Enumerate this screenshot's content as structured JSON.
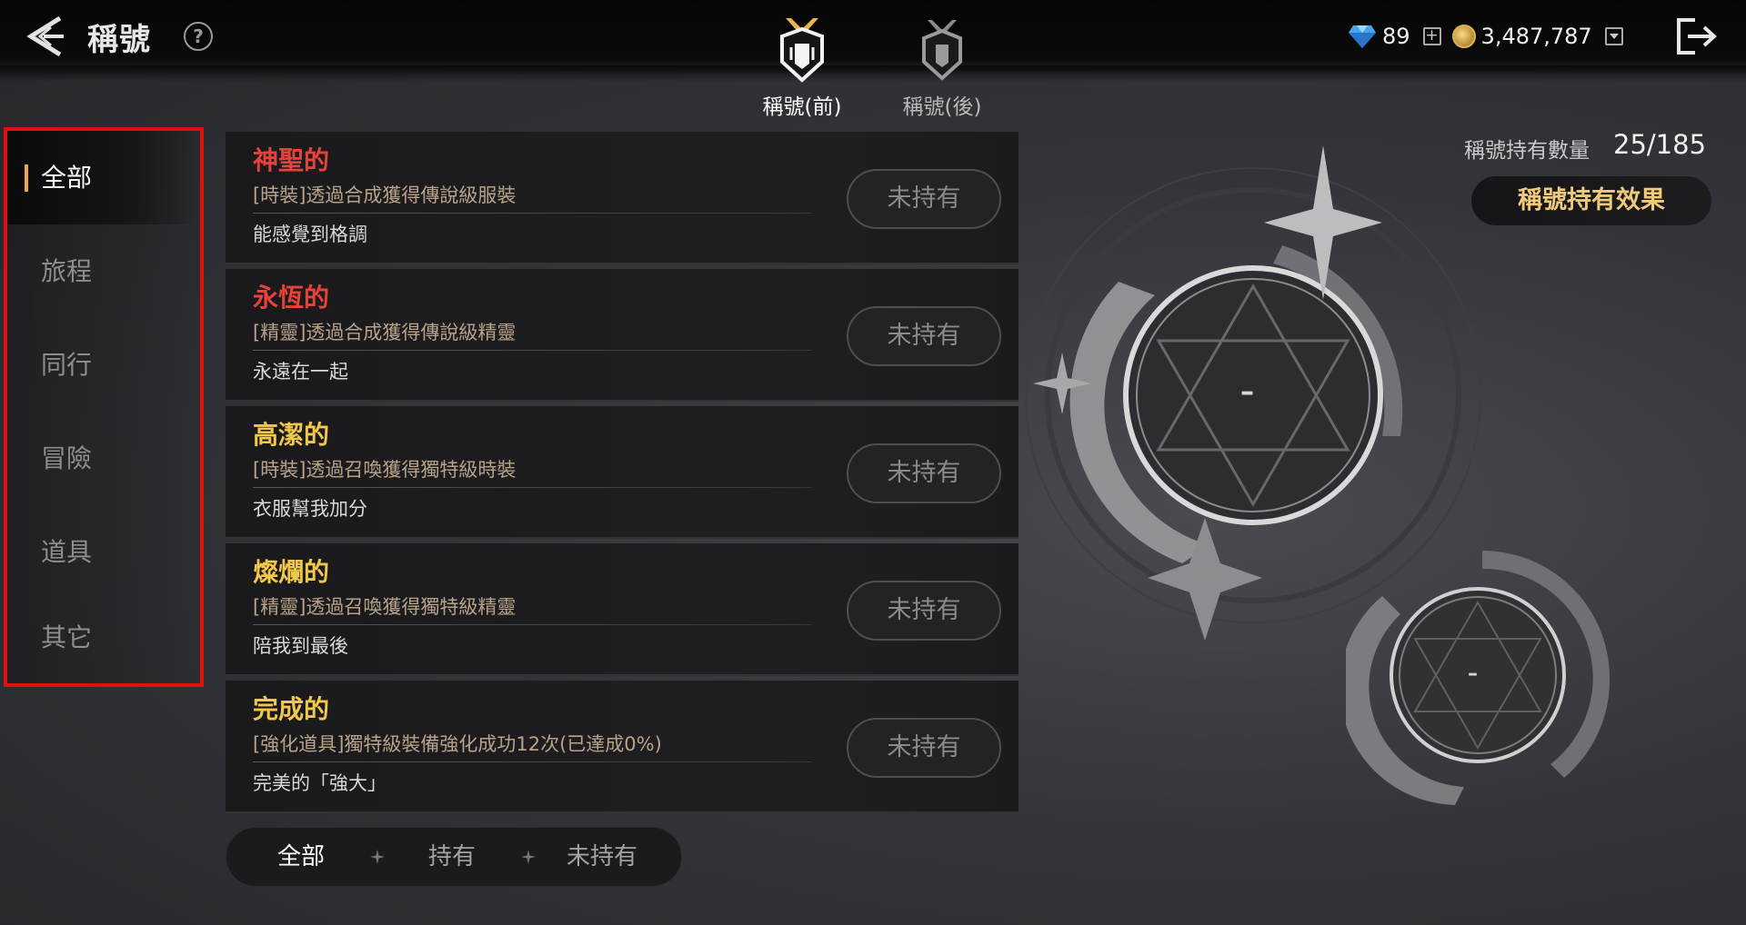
{
  "header": {
    "title": "稱號",
    "help_symbol": "?",
    "tabs": [
      {
        "label": "稱號(前)",
        "active": true
      },
      {
        "label": "稱號(後)",
        "active": false
      }
    ],
    "gems": "89",
    "gold": "3,487,787",
    "plus_symbol": "+"
  },
  "sidebar": {
    "items": [
      {
        "label": "全部",
        "active": true
      },
      {
        "label": "旅程",
        "active": false
      },
      {
        "label": "同行",
        "active": false
      },
      {
        "label": "冒險",
        "active": false
      },
      {
        "label": "道具",
        "active": false
      },
      {
        "label": "其它",
        "active": false
      }
    ]
  },
  "titles": [
    {
      "name": "神聖的",
      "color": "#e7423a",
      "condition": "[時裝]透過合成獲得傳說級服裝",
      "description": "能感覺到格調",
      "status": "未持有"
    },
    {
      "name": "永恆的",
      "color": "#e7423a",
      "condition": "[精靈]透過合成獲得傳說級精靈",
      "description": "永遠在一起",
      "status": "未持有"
    },
    {
      "name": "高潔的",
      "color": "#f2c84a",
      "condition": "[時裝]透過召喚獲得獨特級時裝",
      "description": "衣服幫我加分",
      "status": "未持有"
    },
    {
      "name": "燦爛的",
      "color": "#f2c84a",
      "condition": "[精靈]透過召喚獲得獨特級精靈",
      "description": "陪我到最後",
      "status": "未持有"
    },
    {
      "name": "完成的",
      "color": "#f2c84a",
      "condition": "[強化道具]獨特級裝備強化成功12次(已達成0%)",
      "description": "完美的「強大」",
      "status": "未持有"
    }
  ],
  "filter": {
    "all": "全部",
    "owned": "持有",
    "not_owned": "未持有"
  },
  "right_panel": {
    "count_label": "稱號持有數量",
    "count_value": "25/185",
    "effect_button": "稱號持有效果",
    "front_slot": "–",
    "back_slot": "–"
  },
  "colors": {
    "accent": "#e9a845",
    "highlight_border": "#e01010",
    "legendary": "#e7423a",
    "unique": "#f2c84a",
    "effect_text": "#f0c97b"
  }
}
